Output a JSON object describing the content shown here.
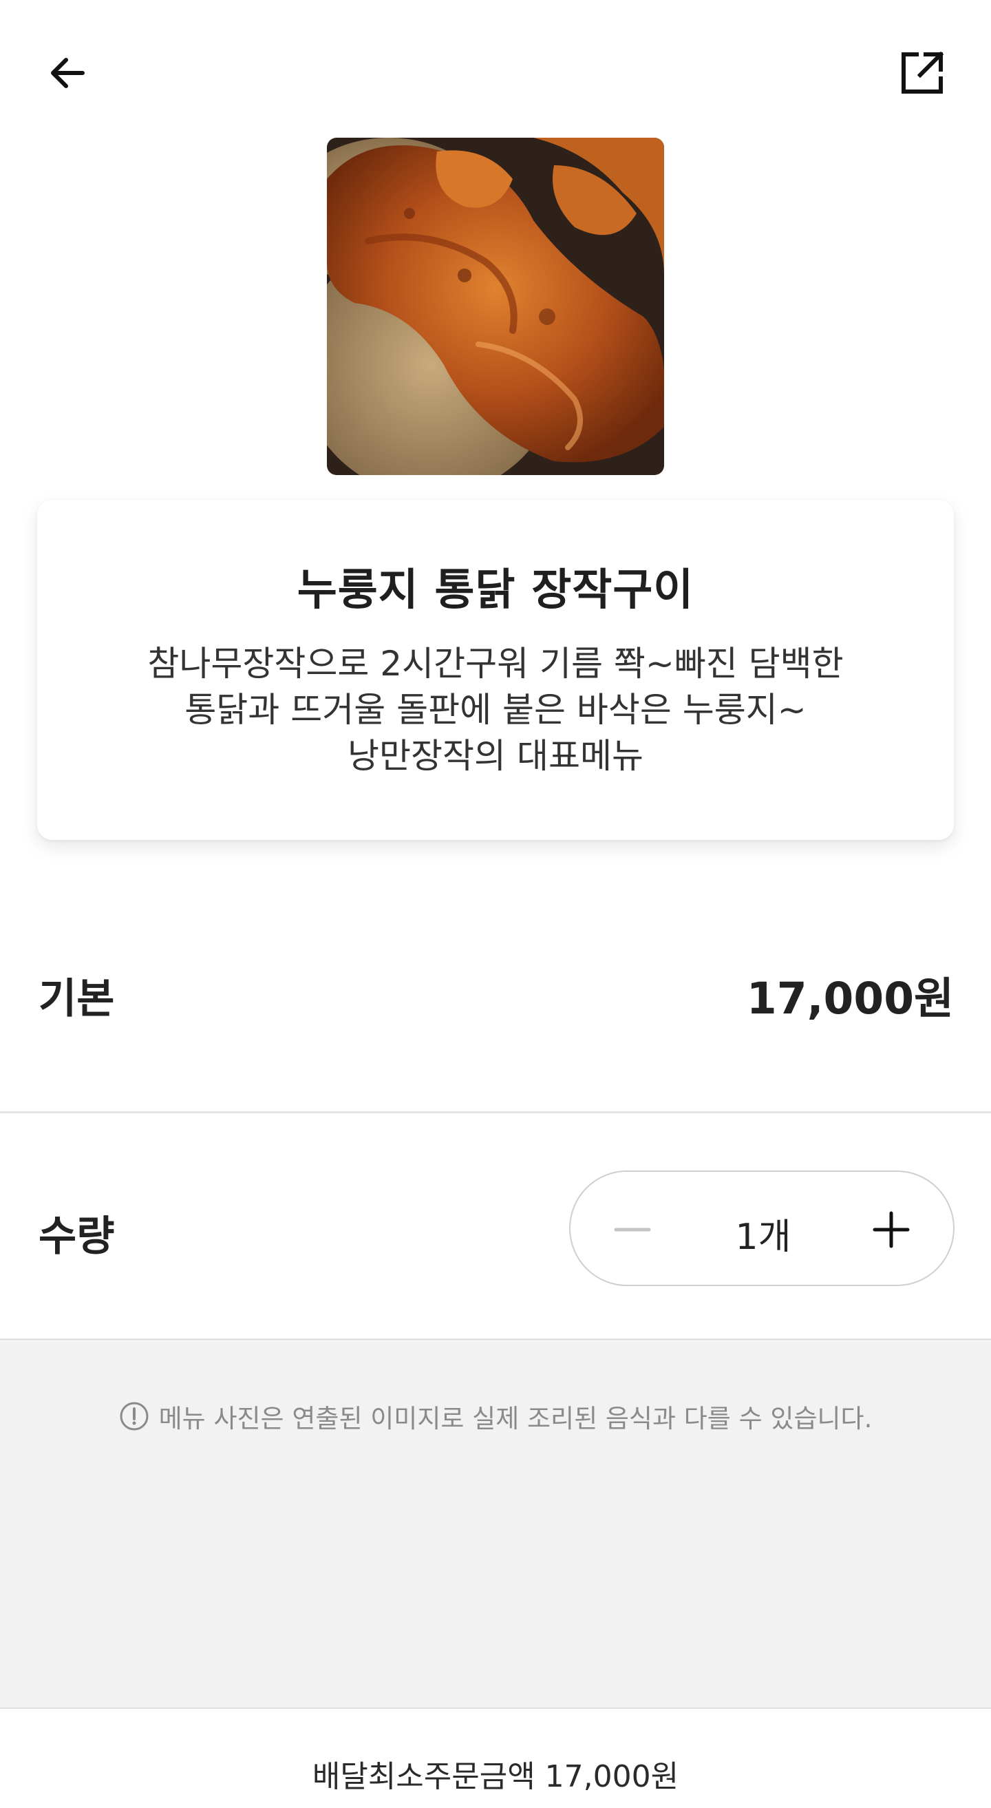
{
  "header": {
    "back_icon": "arrow-left-icon",
    "share_icon": "share-external-icon"
  },
  "menu": {
    "title": "누룽지 통닭 장작구이",
    "description": "참나무장작으로 2시간구워 기름 쫙~빠진 담백한\n통닭과 뜨거울 돌판에 붙은 바삭은 누룽지~\n낭만장작의 대표메뉴"
  },
  "price": {
    "label": "기본",
    "value": "17,000원"
  },
  "quantity": {
    "label": "수량",
    "value": "1개",
    "minus_icon": "minus-icon",
    "plus_icon": "plus-icon"
  },
  "notice": {
    "icon": "exclamation-circle-icon",
    "text": "메뉴 사진은 연출된 이미지로 실제 조리된 음식과 다를 수 있습니다."
  },
  "footer": {
    "min_order": "배달최소주문금액 17,000원"
  },
  "colors": {
    "text_primary": "#1f1f1f",
    "divider": "#e4e4e4",
    "notice_bg": "#f2f2f2",
    "notice_text": "#8a8a8a",
    "minus_disabled": "#c4c4c4"
  }
}
